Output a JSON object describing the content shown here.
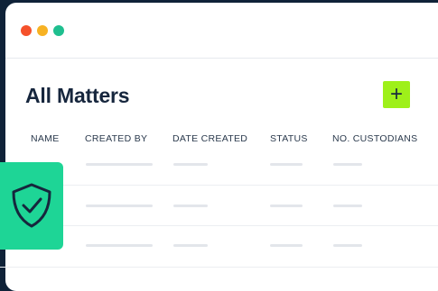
{
  "window": {
    "traffic_lights": [
      "#f5512b",
      "#f7b223",
      "#1fbf8f"
    ]
  },
  "page": {
    "title": "All Matters"
  },
  "toolbar": {
    "add_icon": "plus-icon",
    "add_label": "+",
    "add_color": "#9ef01a"
  },
  "table": {
    "columns": [
      "NAME",
      "CREATED BY",
      "DATE CREATED",
      "STATUS",
      "NO. CUSTODIANS"
    ],
    "row_count": 3
  },
  "badge": {
    "icon": "shield-check-icon",
    "color": "#1ed596"
  }
}
